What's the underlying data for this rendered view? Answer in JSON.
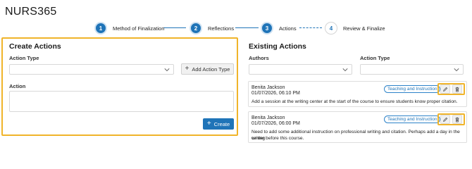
{
  "app": {
    "title": "NURS365"
  },
  "stepper": {
    "steps": [
      {
        "number": "1",
        "label": "Method of Finalization",
        "state": "complete"
      },
      {
        "number": "2",
        "label": "Reflections",
        "state": "complete"
      },
      {
        "number": "3",
        "label": "Actions",
        "state": "current"
      },
      {
        "number": "4",
        "label": "Review & Finalize",
        "state": "upcoming"
      }
    ]
  },
  "create_actions": {
    "title": "Create Actions",
    "action_type_label": "Action Type",
    "action_type_value": "",
    "add_action_type_label": "Add Action Type",
    "action_label": "Action",
    "action_value": "",
    "create_label": "Create"
  },
  "existing_actions": {
    "title": "Existing Actions",
    "authors_label": "Authors",
    "authors_value": "",
    "action_type_label": "Action Type",
    "action_type_value": "",
    "cards": [
      {
        "author": "Benita Jackson",
        "date": "01/07/2026, 06:10 PM",
        "tag": "Teaching and Instruction",
        "text": "Add a session at the writing center at the start of the course to ensure students know proper citation."
      },
      {
        "author": "Benita Jackson",
        "date": "01/07/2026, 06:00 PM",
        "tag": "Teaching and Instruction",
        "text_line1": "Need to add some additional instruction on professional writing and citation. Perhaps add a day in the writing",
        "text_line2": "center before this course."
      }
    ]
  },
  "colors": {
    "accent": "#1f74b8",
    "highlight": "#f0b42a",
    "border": "#d8d8d8"
  },
  "icons": {
    "edit": "pencil-icon",
    "delete": "trash-icon",
    "add": "plus-icon",
    "dropdown": "chevron-down-icon"
  }
}
